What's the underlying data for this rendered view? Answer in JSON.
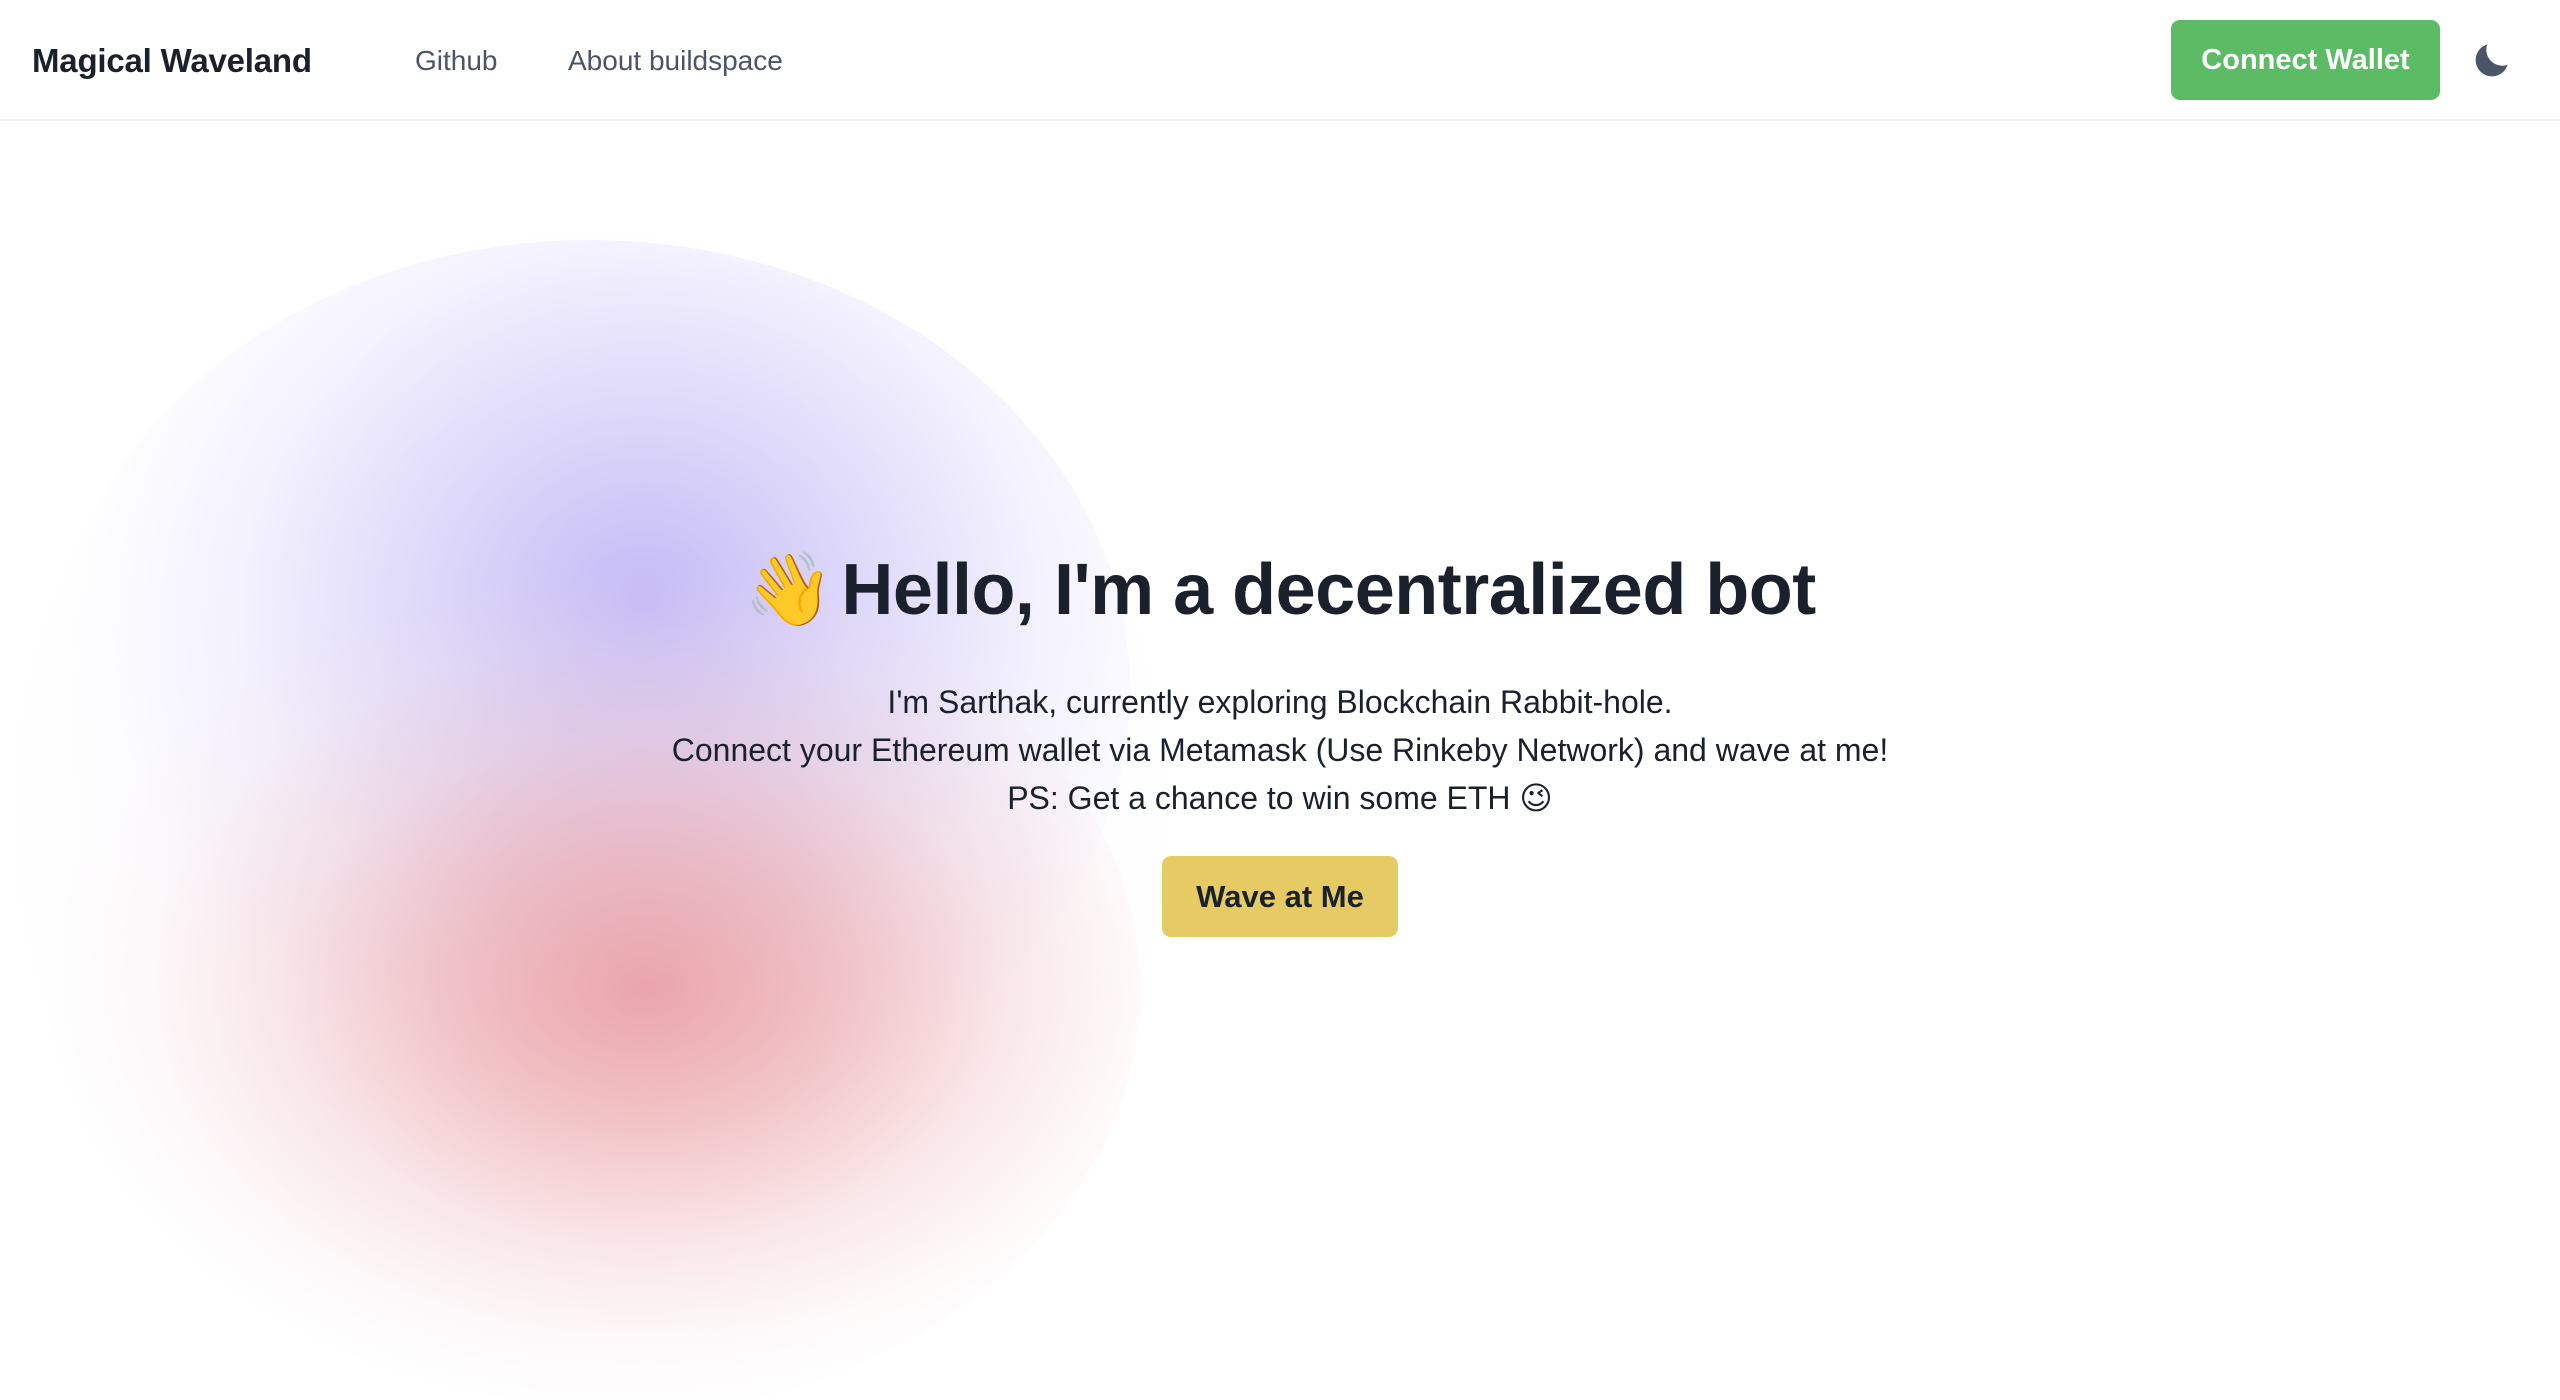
{
  "header": {
    "brand": "Magical Waveland",
    "nav": [
      {
        "label": "Github"
      },
      {
        "label": "About buildspace"
      }
    ],
    "connect_label": "Connect Wallet",
    "theme_icon": "moon-icon"
  },
  "hero": {
    "wave_emoji": "👋",
    "title": "Hello, I'm a decentralized bot",
    "line1": "I'm Sarthak, currently exploring Blockchain Rabbit-hole.",
    "line2": "Connect your Ethereum wallet via Metamask (Use Rinkeby Network) and wave at me!",
    "line3": "PS: Get a chance to win some ETH 😉",
    "button_label": "Wave at Me"
  },
  "colors": {
    "connect_button": "#5bbc65",
    "wave_button": "#e6cb64",
    "text_dark": "#1a202c",
    "nav_text": "#4a5568",
    "blob_violet": "#aca0f2",
    "blob_red": "#e89296"
  }
}
